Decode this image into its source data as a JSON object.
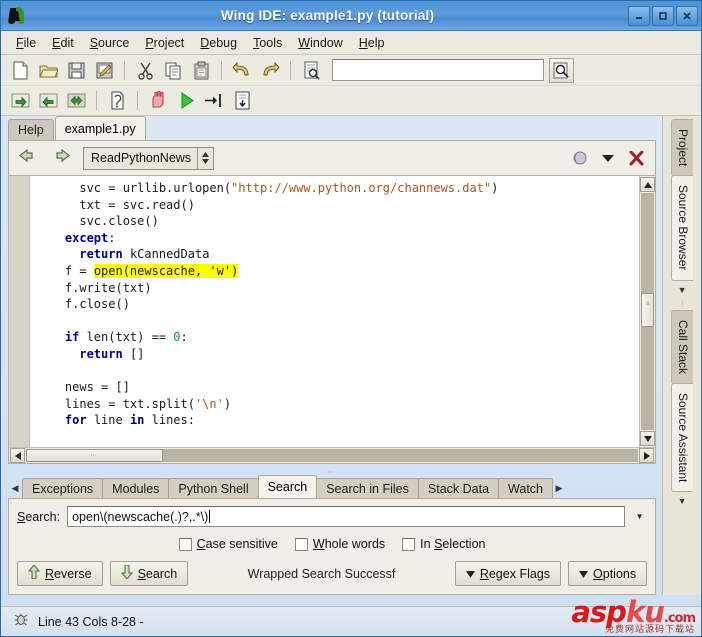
{
  "window": {
    "title": "Wing IDE: example1.py (tutorial)",
    "logo_icon": "wing-ide-logo",
    "controls": [
      {
        "name": "minimize-button",
        "icon": "minimize-icon",
        "label": "–"
      },
      {
        "name": "maximize-button",
        "icon": "maximize-icon",
        "label": "□"
      },
      {
        "name": "close-button",
        "icon": "close-icon",
        "label": "×"
      }
    ]
  },
  "menubar": {
    "items": [
      {
        "label": "File",
        "mnemonic": "F",
        "rest": "ile"
      },
      {
        "label": "Edit",
        "mnemonic": "E",
        "rest": "dit"
      },
      {
        "label": "Source",
        "mnemonic": "S",
        "rest": "ource"
      },
      {
        "label": "Project",
        "mnemonic": "P",
        "rest": "roject"
      },
      {
        "label": "Debug",
        "mnemonic": "D",
        "rest": "ebug"
      },
      {
        "label": "Tools",
        "mnemonic": "T",
        "rest": "ools"
      },
      {
        "label": "Window",
        "mnemonic": "W",
        "rest": "indow"
      },
      {
        "label": "Help",
        "mnemonic": "H",
        "rest": "elp"
      }
    ]
  },
  "toolbar": {
    "row1_icons": [
      "new-file-icon",
      "open-file-icon",
      "save-file-icon",
      "save-as-icon",
      "cut-icon",
      "copy-icon",
      "paste-icon",
      "undo-icon",
      "redo-icon",
      "find-symbol-icon"
    ],
    "search_field_value": "",
    "search_button_icon": "search-magnifier-icon",
    "row2_icons": [
      "forward-icon",
      "back-icon",
      "goto-icon",
      "debug-config-icon",
      "stop-debug-icon",
      "run-icon",
      "step-into-icon",
      "step-over-icon"
    ]
  },
  "editor": {
    "tabs": [
      {
        "label": "Help",
        "active": false
      },
      {
        "label": "example1.py",
        "active": true
      }
    ],
    "nav": {
      "back_icon": "nav-back-arrow-icon",
      "forward_icon": "nav-forward-arrow-icon",
      "symbol": "ReadPythonNews",
      "spin_icon": "spinner-updown-icon",
      "moon_icon": "moon-icon",
      "menu_icon": "chevron-down-icon",
      "close_icon": "close-x-icon"
    },
    "code_lines": [
      {
        "indent": 6,
        "parts": [
          {
            "t": "svc = urllib.urlopen(",
            "c": ""
          },
          {
            "t": "\"http://www.python.org/channews.dat\"",
            "c": "str"
          },
          {
            "t": ")",
            "c": ""
          }
        ]
      },
      {
        "indent": 6,
        "parts": [
          {
            "t": "txt = svc.read()",
            "c": ""
          }
        ]
      },
      {
        "indent": 6,
        "parts": [
          {
            "t": "svc.close()",
            "c": ""
          }
        ]
      },
      {
        "indent": 4,
        "parts": [
          {
            "t": "except",
            "c": "kw"
          },
          {
            "t": ":",
            "c": ""
          }
        ]
      },
      {
        "indent": 6,
        "parts": [
          {
            "t": "return",
            "c": "kw"
          },
          {
            "t": " kCannedData",
            "c": ""
          }
        ]
      },
      {
        "indent": 4,
        "parts": [
          {
            "t": "f = ",
            "c": ""
          },
          {
            "t": "open(newscache, 'w')",
            "c": "hl"
          }
        ]
      },
      {
        "indent": 4,
        "parts": [
          {
            "t": "f.write(txt)",
            "c": ""
          }
        ]
      },
      {
        "indent": 4,
        "parts": [
          {
            "t": "f.close()",
            "c": ""
          }
        ]
      },
      {
        "indent": 0,
        "parts": []
      },
      {
        "indent": 4,
        "parts": [
          {
            "t": "if",
            "c": "kw"
          },
          {
            "t": " len(txt) == ",
            "c": ""
          },
          {
            "t": "0",
            "c": "num"
          },
          {
            "t": ":",
            "c": ""
          }
        ]
      },
      {
        "indent": 6,
        "parts": [
          {
            "t": "return",
            "c": "kw"
          },
          {
            "t": " []",
            "c": ""
          }
        ]
      },
      {
        "indent": 0,
        "parts": []
      },
      {
        "indent": 4,
        "parts": [
          {
            "t": "news = []",
            "c": ""
          }
        ]
      },
      {
        "indent": 4,
        "parts": [
          {
            "t": "lines = txt.split(",
            "c": ""
          },
          {
            "t": "'\\n'",
            "c": "str"
          },
          {
            "t": ")",
            "c": ""
          }
        ]
      },
      {
        "indent": 4,
        "parts": [
          {
            "t": "for",
            "c": "kw"
          },
          {
            "t": " line ",
            "c": ""
          },
          {
            "t": "in",
            "c": "kw"
          },
          {
            "t": " lines:",
            "c": ""
          }
        ]
      }
    ],
    "vscroll_up_icon": "scroll-up-arrow-icon",
    "vscroll_down_icon": "scroll-down-arrow-icon",
    "hscroll_left_icon": "scroll-left-arrow-icon",
    "hscroll_right_icon": "scroll-right-arrow-icon"
  },
  "bottom_panel": {
    "scroll_left_icon": "tab-scroll-left-icon",
    "scroll_right_icon": "tab-scroll-right-icon",
    "tabs": [
      {
        "label": "Exceptions",
        "active": false
      },
      {
        "label": "Modules",
        "active": false
      },
      {
        "label": "Python Shell",
        "active": false
      },
      {
        "label": "Search",
        "active": true
      },
      {
        "label": "Search in Files",
        "active": false
      },
      {
        "label": "Stack Data",
        "active": false
      },
      {
        "label": "Watch",
        "active": false
      }
    ],
    "search": {
      "label": "Search:",
      "label_mnemonic": "S",
      "label_rest": "earch:",
      "value": "open\\(newscache(.)?,.*\\)",
      "history_icon": "chevron-down-icon"
    },
    "checkboxes": [
      {
        "name": "case-sensitive-checkbox",
        "mnemonic": "C",
        "rest": "ase sensitive",
        "checked": false
      },
      {
        "name": "whole-words-checkbox",
        "mnemonic": "W",
        "rest": "hole words",
        "checked": false
      },
      {
        "name": "in-selection-checkbox",
        "pre": "In ",
        "mnemonic": "S",
        "rest": "election",
        "checked": false
      }
    ],
    "buttons": {
      "reverse": {
        "icon": "arrow-up-icon",
        "mnemonic": "R",
        "rest": "everse"
      },
      "search": {
        "icon": "arrow-down-icon",
        "mnemonic": "S",
        "rest": "earch"
      },
      "regex_flags": {
        "icon": "chevron-down-icon",
        "mnemonic": "R",
        "pre": "",
        "rest": "egex Flags"
      },
      "options": {
        "icon": "chevron-down-icon",
        "mnemonic": "O",
        "rest": "ptions"
      }
    },
    "status_message": "Wrapped Search Successf"
  },
  "right_rail": {
    "tabs": [
      {
        "label": "Project",
        "active": true
      },
      {
        "label": "Source Browser",
        "active": false
      },
      {
        "label": "Call Stack",
        "active": true
      },
      {
        "label": "Source Assistant",
        "active": false
      }
    ],
    "arrow_icon": "chevron-down-icon"
  },
  "statusbar": {
    "icon": "debug-bug-icon",
    "text": "Line 43 Cols 8-28 -"
  },
  "watermark": {
    "asp": "asp",
    "ku": "ku",
    "com": ".com",
    "sub": "免费网站源码下载站"
  },
  "colors": {
    "titlebar": "#4e93d8",
    "panel": "#f0eee6",
    "highlight": "#ffff00",
    "keyword": "#00008b",
    "string": "#b3531d",
    "accent_red": "#b02323"
  }
}
